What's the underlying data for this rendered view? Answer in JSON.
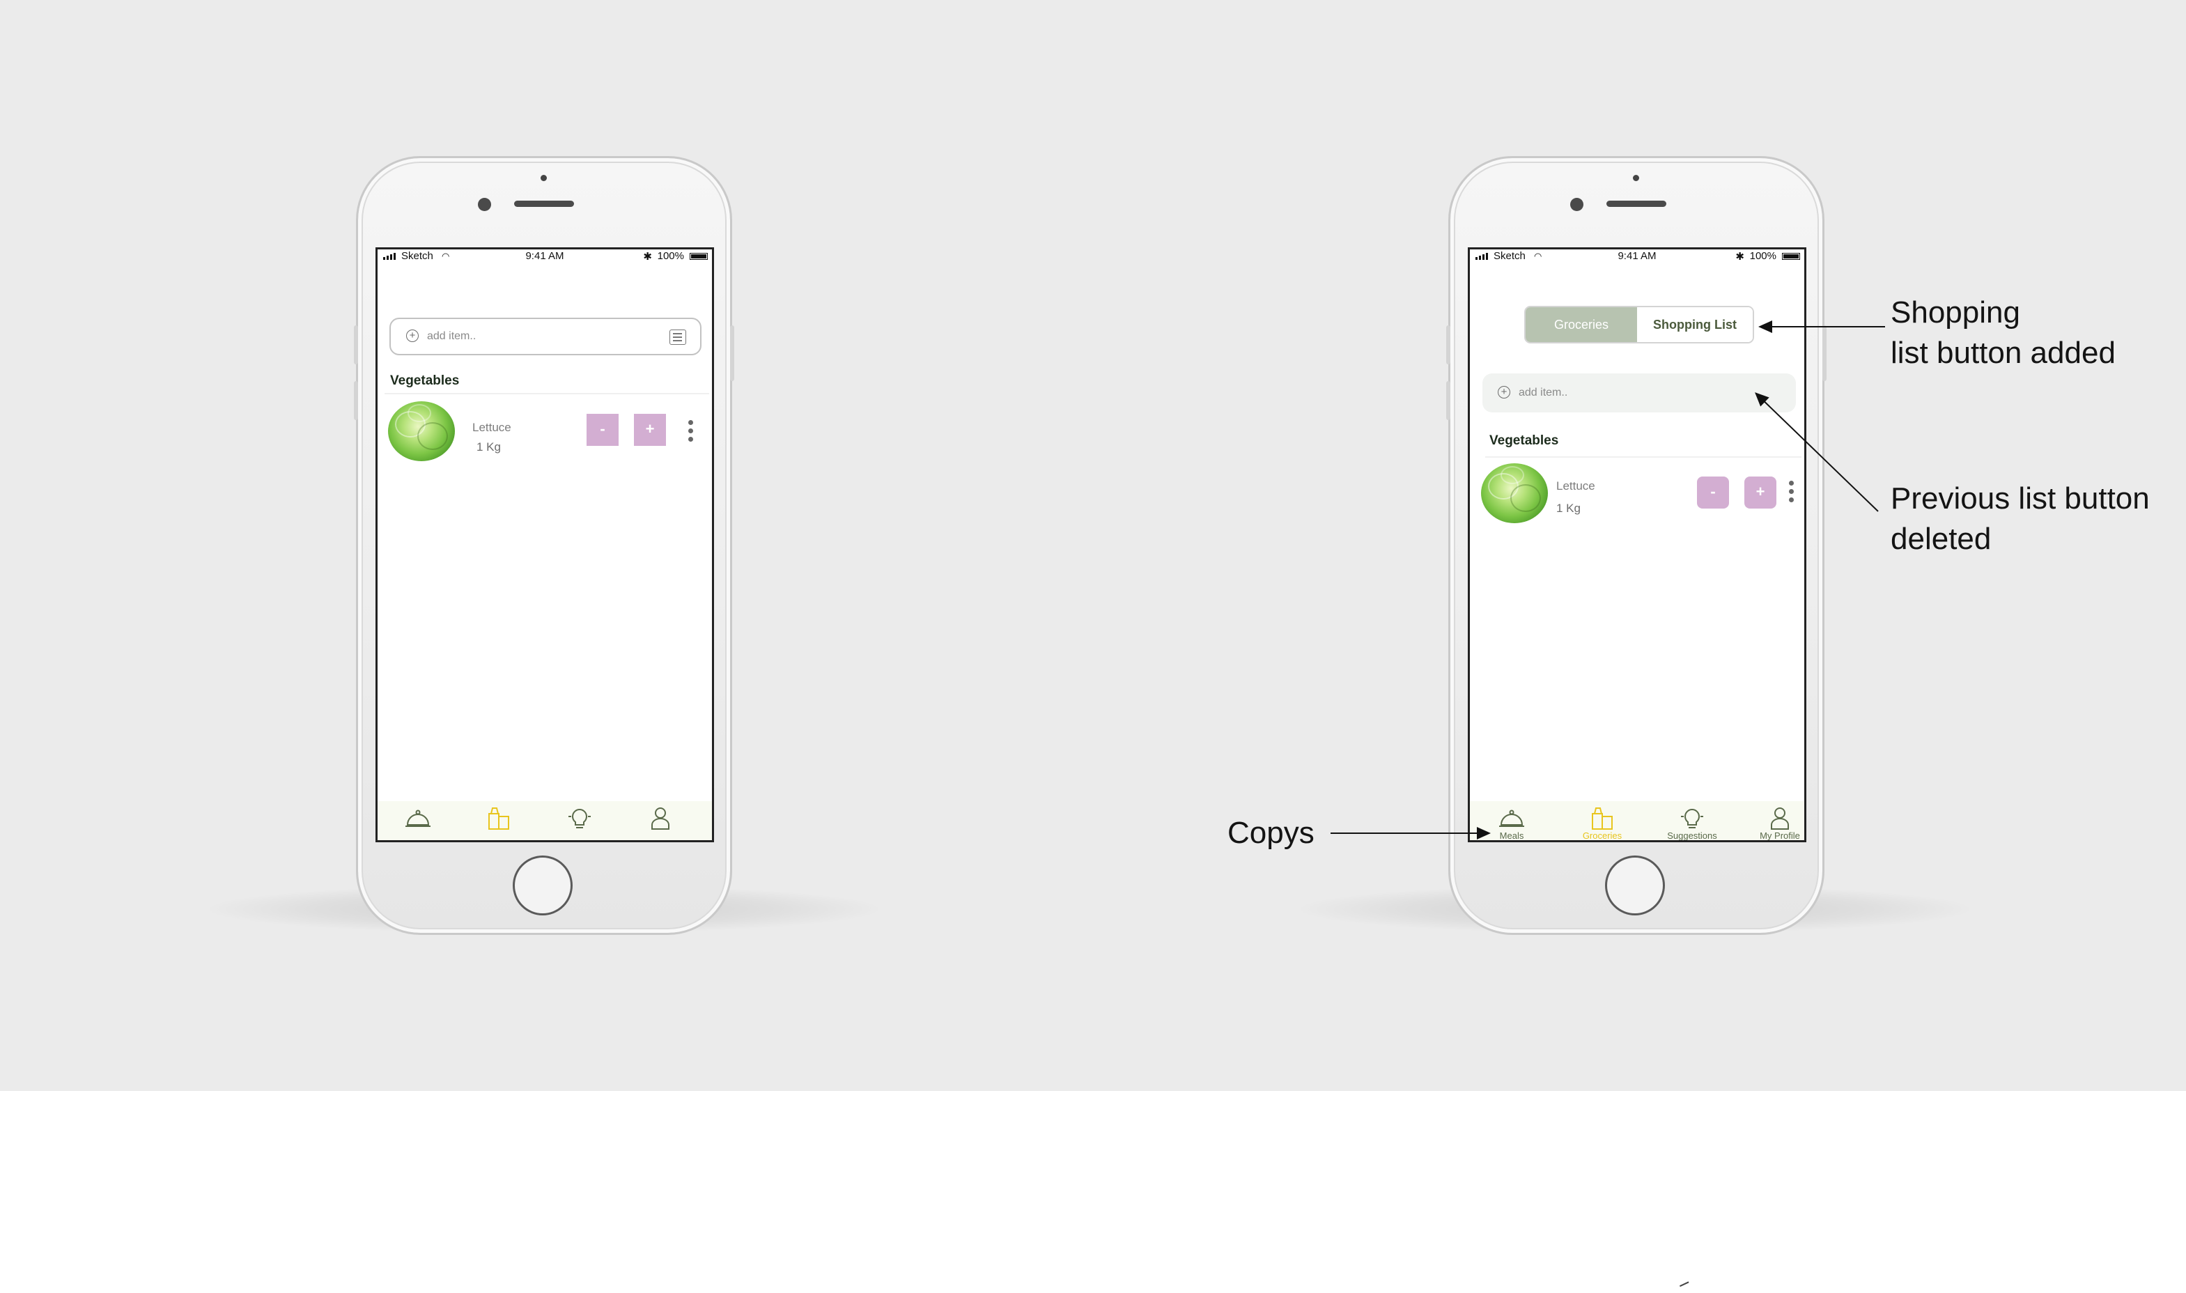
{
  "status_bar": {
    "carrier": "Sketch",
    "time": "9:41 AM",
    "bluetooth": "✱",
    "battery": "100%"
  },
  "before_screen": {
    "search_placeholder": "add item..",
    "section_title": "Vegetables",
    "item": {
      "name": "Lettuce",
      "quantity": "1 Kg",
      "minus_label": "-",
      "plus_label": "+"
    },
    "tabs": [
      {
        "icon": "cloche-icon",
        "active": false
      },
      {
        "icon": "groceries-icon",
        "active": true
      },
      {
        "icon": "lightbulb-icon",
        "active": false
      },
      {
        "icon": "profile-icon",
        "active": false
      }
    ]
  },
  "after_screen": {
    "segment": {
      "groceries": "Groceries",
      "shopping_list": "Shopping List"
    },
    "search_placeholder": "add item..",
    "section_title": "Vegetables",
    "item": {
      "name": "Lettuce",
      "quantity": "1 Kg",
      "minus_label": "-",
      "plus_label": "+"
    },
    "tabs": [
      {
        "label": "Meals",
        "icon": "cloche-icon",
        "active": false
      },
      {
        "label": "Groceries",
        "icon": "groceries-icon",
        "active": true
      },
      {
        "label": "Suggestions",
        "icon": "lightbulb-icon",
        "active": false
      },
      {
        "label": "My Profile",
        "icon": "profile-icon",
        "active": false
      }
    ]
  },
  "annotations": {
    "shopping_list": [
      "Shopping",
      "list button added"
    ],
    "previous_list": [
      "Previous list button",
      "deleted"
    ],
    "copys": "Copys"
  },
  "colors": {
    "background": "#ebebeb",
    "accent_purple": "#d3aed2",
    "segment_active": "#b7c3b0",
    "tab_active": "#e8c51e",
    "tab_inactive": "#5a6a4a"
  }
}
